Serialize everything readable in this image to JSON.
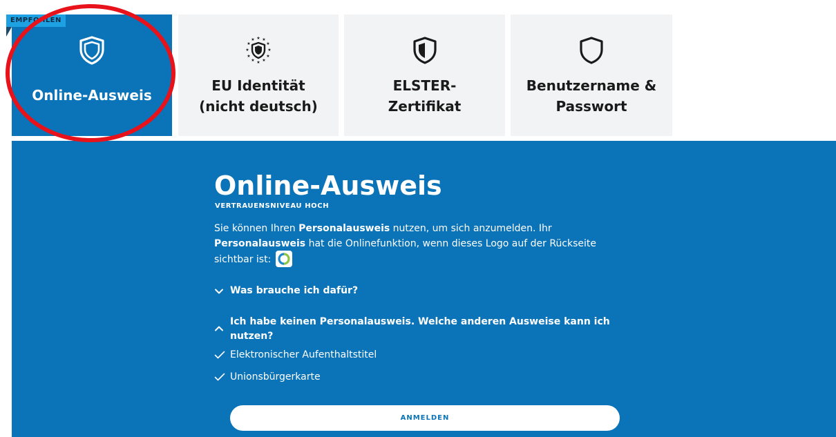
{
  "badge": {
    "label": "EMPFOHLEN"
  },
  "tabs": [
    {
      "id": "online",
      "label": "Online-Ausweis",
      "icon": "shield-icon",
      "active": true
    },
    {
      "id": "eu",
      "label": "EU Identität\n(nicht deutsch)",
      "icon": "eu-stars-shield-icon",
      "active": false
    },
    {
      "id": "elster",
      "label": "ELSTER-\nZertifikat",
      "icon": "half-shield-icon",
      "active": false
    },
    {
      "id": "user",
      "label": "Benutzername &\nPasswort",
      "icon": "shield-outline-icon",
      "active": false
    }
  ],
  "panel": {
    "title": "Online-Ausweis",
    "subtitle": "VERTRAUENSNIVEAU HOCH",
    "description": {
      "part1": "Sie können Ihren ",
      "bold1": "Personalausweis",
      "part2": " nutzen, um sich anzumelden. Ihr ",
      "bold2": "Personalausweis",
      "part3": " hat die Onlinefunktion, wenn dieses Logo auf der Rückseite sichtbar ist:"
    },
    "accordion": [
      {
        "label": "Was brauche ich dafür?",
        "expanded": false
      },
      {
        "label": "Ich habe keinen Personalausweis. Welche anderen Ausweise kann ich nutzen?",
        "expanded": true
      }
    ],
    "alternatives": [
      "Elektronischer Aufenthaltstitel",
      "Unionsbürgerkarte"
    ],
    "login_button": "ANMELDEN"
  },
  "colors": {
    "primary": "#0b73b7",
    "tab_inactive": "#f2f3f4",
    "badge": "#1ea1e3",
    "highlight_circle": "#e8121b"
  }
}
